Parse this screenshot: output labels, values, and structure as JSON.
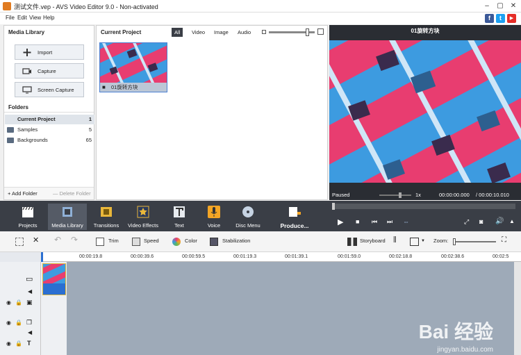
{
  "window": {
    "title": "测试文件.vep - AVS Video Editor 9.0 - Non-activated"
  },
  "menu": [
    "File",
    "Edit",
    "View",
    "Help"
  ],
  "social": [
    {
      "icon": "facebook-icon",
      "glyph": "f",
      "color": "#3b5998"
    },
    {
      "icon": "twitter-icon",
      "glyph": "t",
      "color": "#1da1f2"
    },
    {
      "icon": "youtube-icon",
      "glyph": "▶",
      "color": "#e52d27"
    }
  ],
  "media_library": {
    "title": "Media Library",
    "buttons": [
      {
        "label": "Import",
        "icon": "plus-icon"
      },
      {
        "label": "Capture",
        "icon": "camera-icon"
      },
      {
        "label": "Screen Capture",
        "icon": "monitor-icon"
      }
    ],
    "folders_title": "Folders",
    "folders": [
      {
        "name": "Current Project",
        "count": "1"
      },
      {
        "name": "Samples",
        "count": "5"
      },
      {
        "name": "Backgrounds",
        "count": "65"
      }
    ],
    "add_folder": "+ Add Folder",
    "delete_folder": "— Delete Folder"
  },
  "project": {
    "title": "Current Project",
    "filters": [
      "All",
      "Video",
      "Image",
      "Audio"
    ],
    "active_filter": "All",
    "zoom_level": 0.85,
    "clip_name": "01旋转方块"
  },
  "preview": {
    "title": "01旋转方块",
    "status": "Paused",
    "speed": "1x",
    "time": "00:00:00.000",
    "duration": "/ 00:00:10.010",
    "position": 0.0
  },
  "tools": [
    {
      "label": "Projects",
      "icon": "clapper-icon",
      "color": "#ffffff"
    },
    {
      "label": "Media Library",
      "icon": "film-library-icon",
      "color": "#8fb0d6"
    },
    {
      "label": "Transitions",
      "icon": "transitions-icon",
      "color": "#e9b73a"
    },
    {
      "label": "Video Effects",
      "icon": "star-effects-icon",
      "color": "#e9b73a"
    },
    {
      "label": "Text",
      "icon": "text-t-icon",
      "color": "#ffffff"
    },
    {
      "label": "Voice",
      "icon": "microphone-icon",
      "color": "#f3a525"
    },
    {
      "label": "Disc Menu",
      "icon": "disc-icon",
      "color": "#c6d3e3"
    },
    {
      "label": "Produce...",
      "icon": "produce-clapper-icon",
      "color": "#ffffff"
    }
  ],
  "timeline_toolbar": {
    "trim": "Trim",
    "speed": "Speed",
    "color": "Color",
    "stabilization": "Stabilization",
    "storyboard": "Storyboard",
    "zoom": "Zoom:"
  },
  "ruler": [
    "00:00:19.8",
    "00:00:39.6",
    "00:00:59.5",
    "00:01:19.3",
    "00:01:39.1",
    "00:01:59.0",
    "00:02:18.8",
    "00:02:38.6",
    "00:02:5"
  ],
  "watermark": {
    "brand": "Bai 经验",
    "url": "jingyan.baidu.com"
  }
}
